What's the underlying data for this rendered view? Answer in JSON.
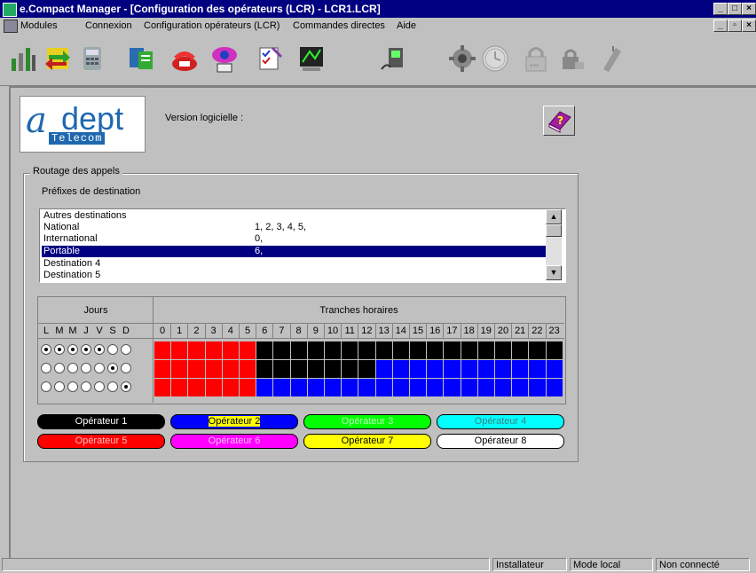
{
  "window": {
    "title": "e.Compact Manager - [Configuration des opérateurs (LCR) - LCR1.LCR]"
  },
  "menu": [
    "Modules",
    "Connexion",
    "Configuration opérateurs (LCR)",
    "Commandes directes",
    "Aide"
  ],
  "toolbar_icons": [
    "network-icon",
    "transfer-icon",
    "phone-icon",
    "directory-icon",
    "telephone-icon",
    "monitor-icon",
    "checklist-icon",
    "programming-icon",
    "terminal-icon",
    "gear-icon",
    "clock-icon",
    "lock-icon",
    "lock-camera-icon",
    "mobile-icon"
  ],
  "logo": {
    "text_a": "a",
    "text_dept": "dept",
    "text_telecom": "Telecom"
  },
  "version_label": "Version logicielle :",
  "routing": {
    "group_title": "Routage des appels",
    "prefix_label": "Préfixes de destination",
    "destinations": [
      {
        "name": "Autres destinations",
        "prefixes": ""
      },
      {
        "name": "National",
        "prefixes": "1, 2, 3, 4, 5,"
      },
      {
        "name": "International",
        "prefixes": "0,"
      },
      {
        "name": "Portable",
        "prefixes": "6,",
        "selected": true
      },
      {
        "name": "Destination 4",
        "prefixes": ""
      },
      {
        "name": "Destination 5",
        "prefixes": ""
      }
    ]
  },
  "schedule": {
    "days_header": "Jours",
    "hours_header": "Tranches horaires",
    "day_letters": [
      "L",
      "M",
      "M",
      "J",
      "V",
      "S",
      "D"
    ],
    "hours": [
      "0",
      "1",
      "2",
      "3",
      "4",
      "5",
      "6",
      "7",
      "8",
      "9",
      "10",
      "11",
      "12",
      "13",
      "14",
      "15",
      "16",
      "17",
      "18",
      "19",
      "20",
      "21",
      "22",
      "23"
    ],
    "rows": [
      {
        "days_selected": [
          true,
          true,
          true,
          true,
          true,
          false,
          false
        ],
        "operators": [
          5,
          5,
          5,
          5,
          5,
          5,
          1,
          1,
          1,
          1,
          1,
          1,
          1,
          1,
          1,
          1,
          1,
          1,
          1,
          1,
          1,
          1,
          1,
          1
        ]
      },
      {
        "days_selected": [
          false,
          false,
          false,
          false,
          false,
          true,
          false
        ],
        "operators": [
          5,
          5,
          5,
          5,
          5,
          5,
          1,
          1,
          1,
          1,
          1,
          1,
          1,
          2,
          2,
          2,
          2,
          2,
          2,
          2,
          2,
          2,
          2,
          2
        ]
      },
      {
        "days_selected": [
          false,
          false,
          false,
          false,
          false,
          false,
          true
        ],
        "operators": [
          5,
          5,
          5,
          5,
          5,
          5,
          2,
          2,
          2,
          2,
          2,
          2,
          2,
          2,
          2,
          2,
          2,
          2,
          2,
          2,
          2,
          2,
          2,
          2
        ]
      }
    ]
  },
  "operators": [
    {
      "id": 1,
      "label": "Opérateur 1",
      "bg": "#000000",
      "fg": "#ffffff"
    },
    {
      "id": 2,
      "label": "Opérateur 2",
      "bg": "#0000ff",
      "fg": "#000000",
      "label_highlight": "#ffff00"
    },
    {
      "id": 3,
      "label": "Opérateur 3",
      "bg": "#00ff00",
      "fg": "#c0ffc0"
    },
    {
      "id": 4,
      "label": "Opérateur 4",
      "bg": "#00ffff",
      "fg": "#408080"
    },
    {
      "id": 5,
      "label": "Opérateur 5",
      "bg": "#ff0000",
      "fg": "#ffc0c0"
    },
    {
      "id": 6,
      "label": "Opérateur 6",
      "bg": "#ff00ff",
      "fg": "#ffc0ff"
    },
    {
      "id": 7,
      "label": "Opérateur 7",
      "bg": "#ffff00",
      "fg": "#000000"
    },
    {
      "id": 8,
      "label": "Opérateur 8",
      "bg": "#ffffff",
      "fg": "#000000"
    }
  ],
  "status": {
    "user": "Installateur",
    "mode": "Mode local",
    "connection": "Non connecté"
  }
}
